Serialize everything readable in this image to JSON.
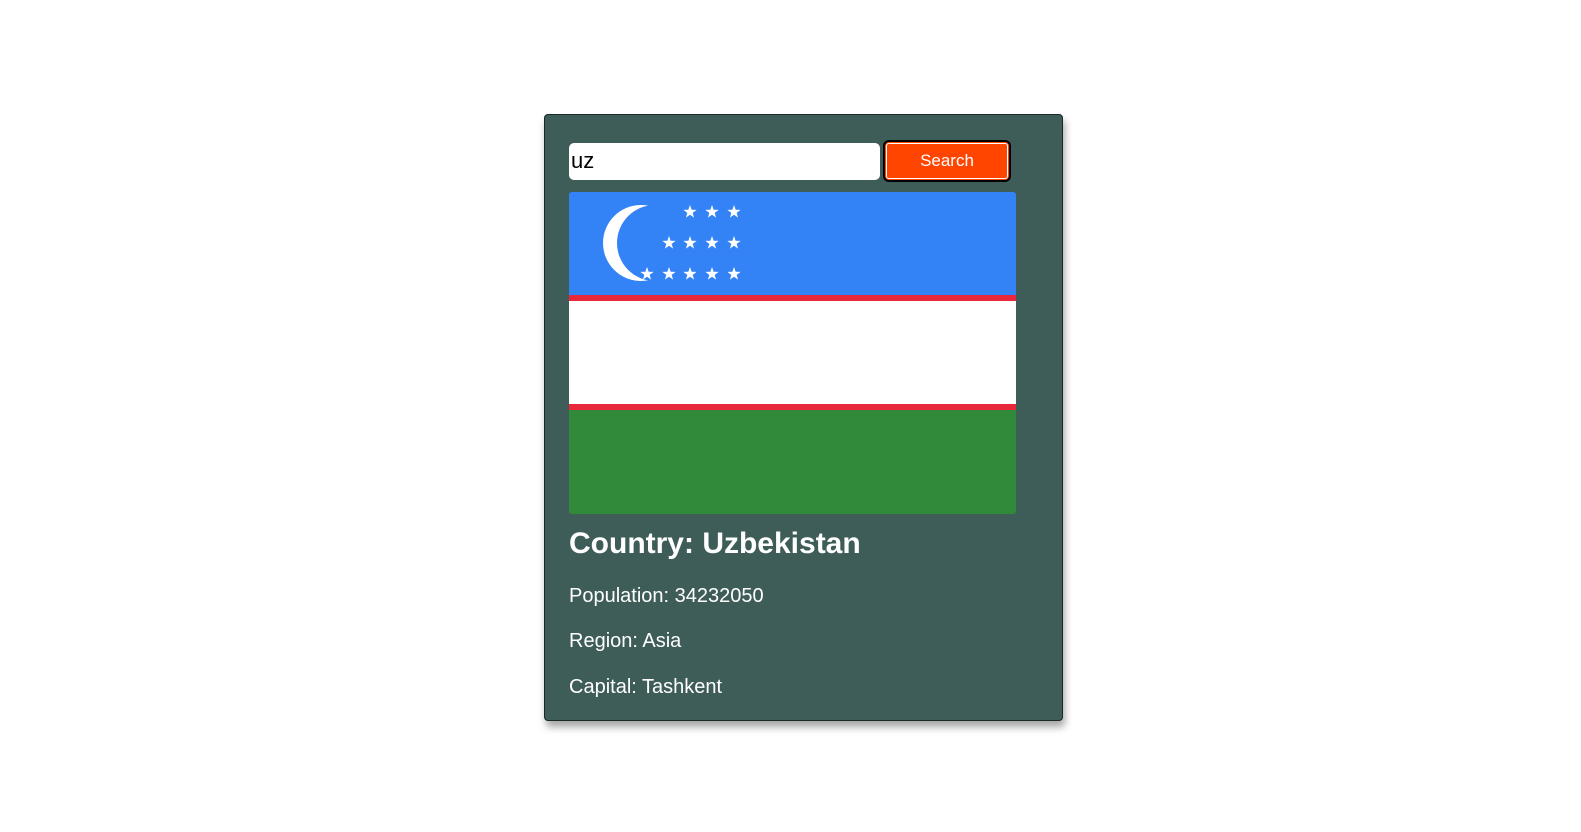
{
  "search": {
    "value": "uz",
    "button_label": "Search"
  },
  "flag": {
    "colors": {
      "blue": "#3382f6",
      "red": "#e8283a",
      "white": "#ffffff",
      "green": "#318a3a"
    }
  },
  "country": {
    "title": "Country: Uzbekistan",
    "population": "Population: 34232050",
    "region": "Region: Asia",
    "capital": "Capital: Tashkent"
  },
  "colors": {
    "card_background": "#3e5c58",
    "button_background": "#ff4500"
  }
}
